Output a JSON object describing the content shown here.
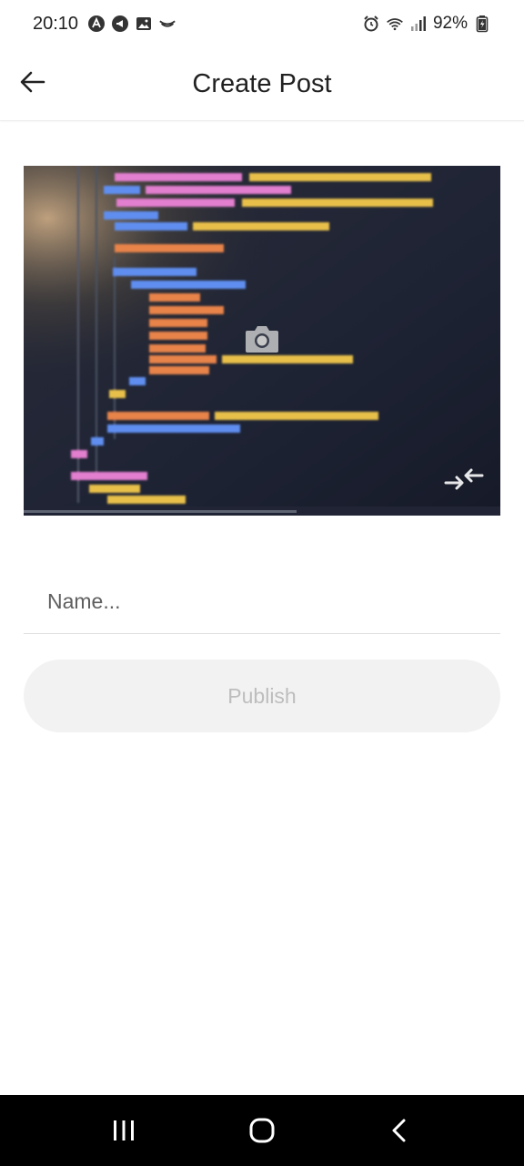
{
  "status_bar": {
    "time": "20:10",
    "battery": "92%"
  },
  "header": {
    "title": "Create Post"
  },
  "form": {
    "name_placeholder": "Name...",
    "name_value": "",
    "publish_label": "Publish"
  },
  "colors": {
    "publish_bg": "#f2f2f2",
    "publish_text": "#bdbdbd",
    "nav_bar": "#000000"
  },
  "icons": {
    "back": "arrow-left-icon",
    "camera": "camera-icon",
    "flip": "flip-camera-icon",
    "nav_recent": "recent-apps-icon",
    "nav_home": "home-icon",
    "nav_back": "back-icon"
  }
}
